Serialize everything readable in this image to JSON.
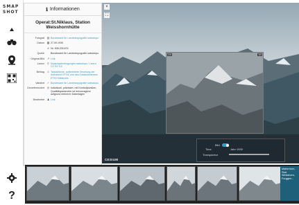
{
  "app": {
    "logo_text": "SMAP\nSHOT"
  },
  "panel": {
    "header_label": "Informationen",
    "title": "Operat:St.Niklaus, Station Weisshornhütte",
    "rows": [
      {
        "label": "Fotograf",
        "icon": "book-icon",
        "value": "Bundesamt für Landestopografie swisstopo",
        "link": true
      },
      {
        "label": "Datum",
        "icon": "calendar-icon",
        "value": "27.09.1930",
        "link": false
      },
      {
        "label": "",
        "icon": "id-icon",
        "value": "Nr. 508-2011/03",
        "link": false
      },
      {
        "label": "Quelle",
        "icon": "",
        "value": "Bundesamt für Landestopografie swisstopo",
        "link": false
      },
      {
        "label": "Original-Bild",
        "icon": "external-link-icon",
        "value": "Link",
        "link": true
      },
      {
        "label": "Lizenz",
        "icon": "cc-icon",
        "value": "Nutzungsbedingungen swisstopo / Lizenz CC BY 4.0",
        "link": true
      },
      {
        "label": "Beitrag",
        "icon": "user-icon",
        "value": "Tatsächliche, aufbereitete Verortung der Aufnahme ETHZ und des Entwicklerteams ETHZ Bildarchiv",
        "link": true
      },
      {
        "label": "Validiert",
        "icon": "check-icon",
        "value": "Bundesamt für Landestopografie swisstopo",
        "link": true
      },
      {
        "label": "Georeferenziert",
        "icon": "globe-icon",
        "value": "Individuell, präzisiert, mit Kontrollpunkten, Qualitätsparameter ist hervorragend aufgrund mehrerer Datenlagen",
        "link": false
      },
      {
        "label": "Bearbeitet",
        "icon": "person-icon",
        "value": "Link",
        "link": true
      }
    ]
  },
  "map": {
    "attribution": "CESIUM",
    "photo_tag_left": "1/4",
    "photo_tag_right": "1/4",
    "control_label": "Bild",
    "control_time_label": "Time",
    "control_date": "Jahr 1930",
    "control_transparency": "Transparenz"
  },
  "strip": {
    "info_lines": [
      "Matterhorn, Stat.",
      "Weisshorn,",
      "Furggen..."
    ],
    "thumbnails": 8
  },
  "colors": {
    "accent": "#3a9bc1",
    "rail": "#ffffff"
  }
}
